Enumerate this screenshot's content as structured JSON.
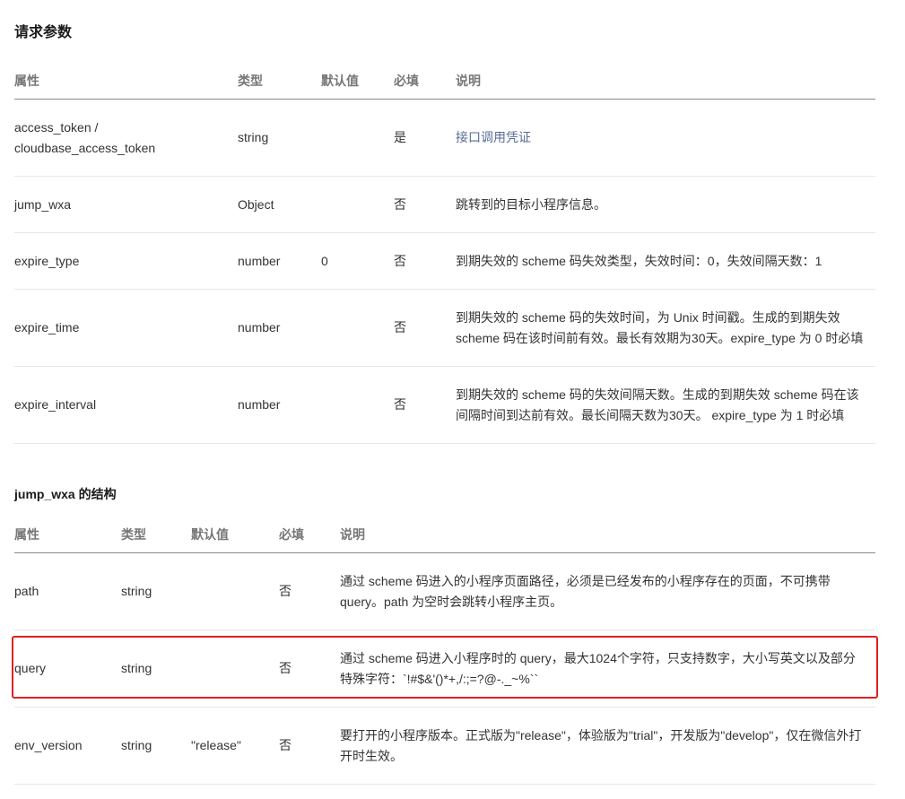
{
  "section1": {
    "title": "请求参数",
    "headers": [
      "属性",
      "类型",
      "默认值",
      "必填",
      "说明"
    ],
    "rows": [
      {
        "attr_line1": "access_token /",
        "attr_line2": "cloudbase_access_token",
        "type": "string",
        "default": "",
        "required": "是",
        "desc": "接口调用凭证"
      },
      {
        "attr": "jump_wxa",
        "type": "Object",
        "default": "",
        "required": "否",
        "desc": "跳转到的目标小程序信息。"
      },
      {
        "attr": "expire_type",
        "type": "number",
        "default": "0",
        "required": "否",
        "desc": "到期失效的 scheme 码失效类型，失效时间：0，失效间隔天数：1"
      },
      {
        "attr": "expire_time",
        "type": "number",
        "default": "",
        "required": "否",
        "desc_line1": "到期失效的 scheme 码的失效时间，为 Unix 时间戳。生成的到期失效",
        "desc_line2": "scheme 码在该时间前有效。最长有效期为30天。expire_type 为 0 时必填"
      },
      {
        "attr": "expire_interval",
        "type": "number",
        "default": "",
        "required": "否",
        "desc_line1": "到期失效的 scheme 码的失效间隔天数。生成的到期失效 scheme 码在该",
        "desc_line2": "间隔时间到达前有效。最长间隔天数为30天。 expire_type 为 1 时必填"
      }
    ]
  },
  "section2": {
    "title": "jump_wxa 的结构",
    "headers": [
      "属性",
      "类型",
      "默认值",
      "必填",
      "说明"
    ],
    "rows": [
      {
        "attr": "path",
        "type": "string",
        "default": "",
        "required": "否",
        "desc_line1": "通过 scheme 码进入的小程序页面路径，必须是已经发布的小程序存在的页面，不可携带",
        "desc_line2": "query。path 为空时会跳转小程序主页。"
      },
      {
        "attr": "query",
        "type": "string",
        "default": "",
        "required": "否",
        "desc_line1": "通过 scheme 码进入小程序时的 query，最大1024个字符，只支持数字，大小写英文以及部分",
        "desc_line2": "特殊字符：`!#$&'()*+,/:;=?@-._~%``"
      },
      {
        "attr": "env_version",
        "type": "string",
        "default": "\"release\"",
        "required": "否",
        "desc_line1": "要打开的小程序版本。正式版为\"release\"，体验版为\"trial\"，开发版为\"develop\"，仅在微信外打",
        "desc_line2": "开时生效。"
      }
    ]
  },
  "colors": {
    "link": "#576b95",
    "highlight": "#e02020",
    "header_text": "#777777"
  }
}
